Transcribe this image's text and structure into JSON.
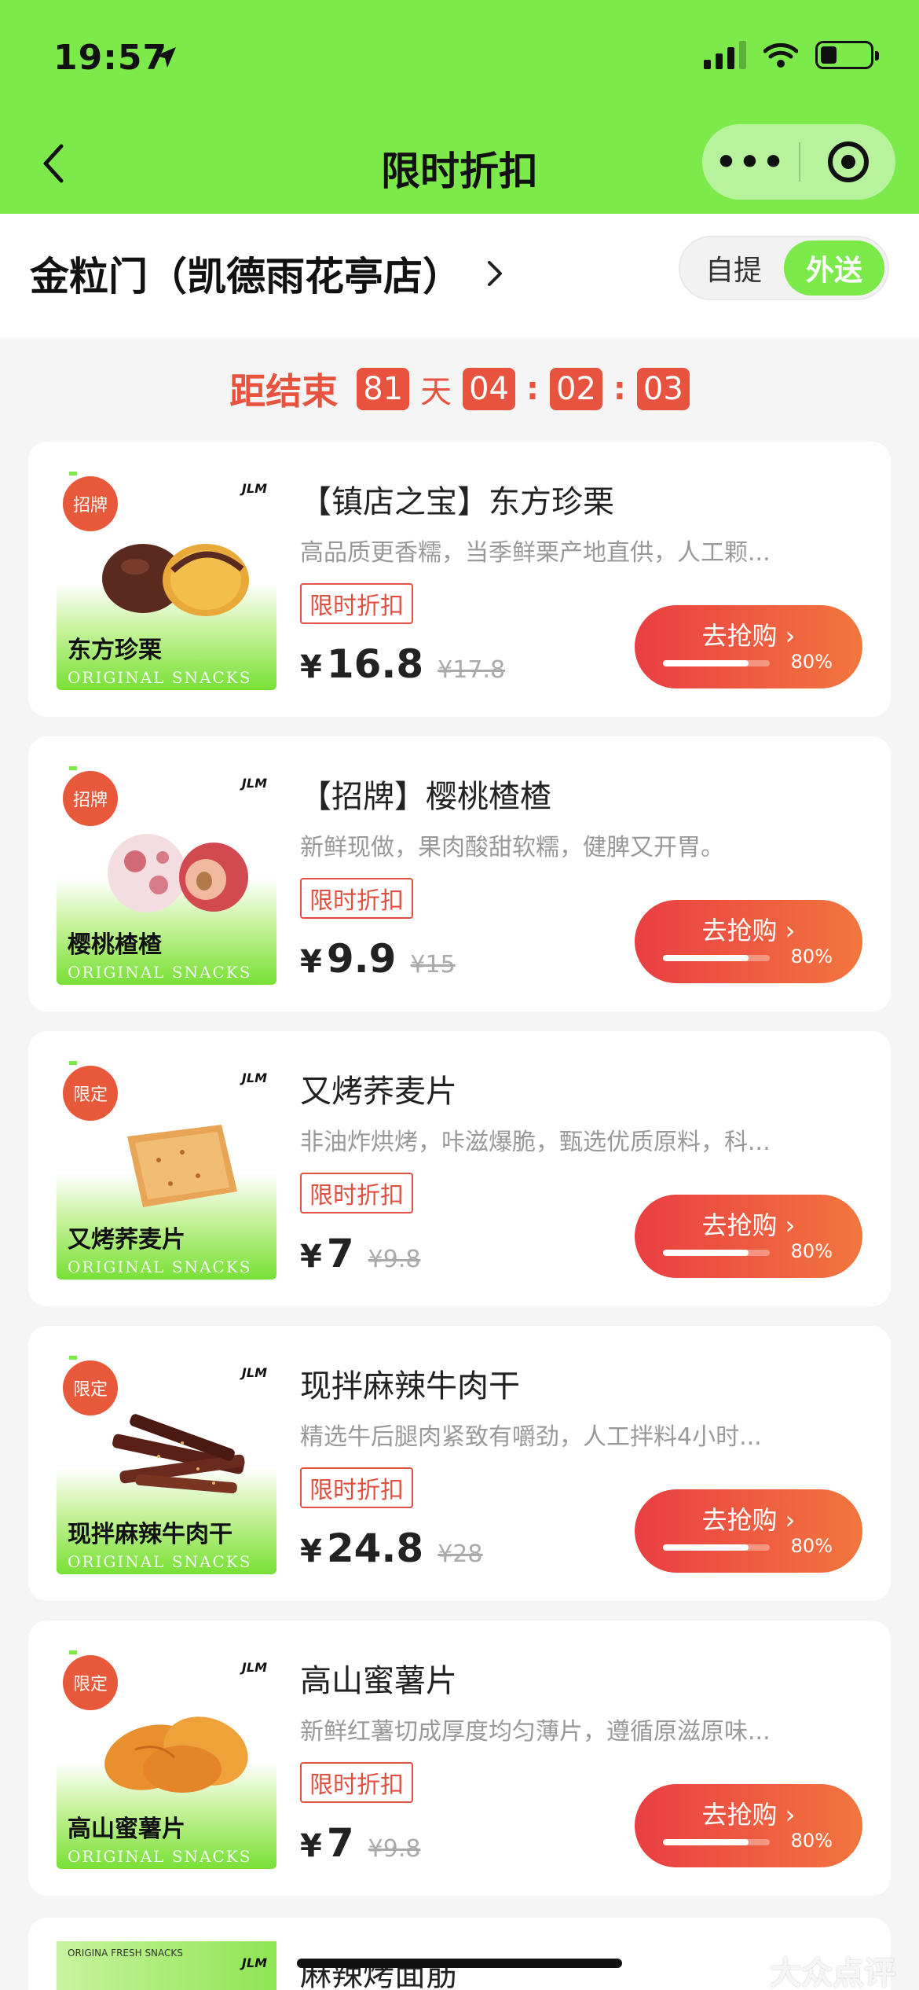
{
  "status_bar": {
    "time": "19:57"
  },
  "nav": {
    "title": "限时折扣",
    "more_icon": "more-dots-icon",
    "target_icon": "target-icon"
  },
  "store": {
    "name": "金粒门（凯德雨花亭店）",
    "pickup": "自提",
    "delivery": "外送",
    "active": "外送"
  },
  "countdown": {
    "label": "距结束",
    "days": "81",
    "day_unit": "天",
    "hours": "04",
    "minutes": "02",
    "seconds": "03",
    "sep": ":"
  },
  "products": [
    {
      "title": "【镇店之宝】东方珍栗",
      "desc": "高品质更香糯，当季鲜栗产地直供，人工颗...",
      "tag": "限时折扣",
      "yen": "¥",
      "price": "16.8",
      "orig_price": "¥17.8",
      "button": "去抢购 ›",
      "progress": 0.8,
      "progress_label": "80%",
      "thumb_tag": "招牌",
      "thumb_name": "东方珍栗",
      "thumb_sub": "ORIGINAL SNACKS",
      "thumb_logo": "JLM"
    },
    {
      "title": "【招牌】樱桃楂楂",
      "desc": "新鲜现做，果肉酸甜软糯，健脾又开胃。",
      "tag": "限时折扣",
      "yen": "¥",
      "price": "9.9",
      "orig_price": "¥15",
      "button": "去抢购 ›",
      "progress": 0.8,
      "progress_label": "80%",
      "thumb_tag": "招牌",
      "thumb_name": "樱桃楂楂",
      "thumb_sub": "ORIGINAL SNACKS",
      "thumb_logo": "JLM"
    },
    {
      "title": "又烤荞麦片",
      "desc": "非油炸烘烤，咔滋爆脆，甄选优质原料，科...",
      "tag": "限时折扣",
      "yen": "¥",
      "price": "7",
      "orig_price": "¥9.8",
      "button": "去抢购 ›",
      "progress": 0.8,
      "progress_label": "80%",
      "thumb_tag": "限定",
      "thumb_name": "又烤荞麦片",
      "thumb_sub": "ORIGINAL SNACKS",
      "thumb_logo": "JLM"
    },
    {
      "title": "现拌麻辣牛肉干",
      "desc": "精选牛后腿肉紧致有嚼劲，人工拌料4小时...",
      "tag": "限时折扣",
      "yen": "¥",
      "price": "24.8",
      "orig_price": "¥28",
      "button": "去抢购 ›",
      "progress": 0.8,
      "progress_label": "80%",
      "thumb_tag": "限定",
      "thumb_name": "现拌麻辣牛肉干",
      "thumb_sub": "ORIGINAL SNACKS",
      "thumb_logo": "JLM"
    },
    {
      "title": "高山蜜薯片",
      "desc": "新鲜红薯切成厚度均匀薄片，遵循原滋原味...",
      "tag": "限时折扣",
      "yen": "¥",
      "price": "7",
      "orig_price": "¥9.8",
      "button": "去抢购 ›",
      "progress": 0.8,
      "progress_label": "80%",
      "thumb_tag": "限定",
      "thumb_name": "高山蜜薯片",
      "thumb_sub": "ORIGINAL SNACKS",
      "thumb_logo": "JLM"
    }
  ],
  "partial_product": {
    "title": "麻辣烤面筋",
    "thumb_text": "ORIGINA FRESH SNACKS",
    "thumb_logo": "JLM"
  },
  "watermark": "大众点评",
  "colors": {
    "brand_green": "#7dea4c",
    "accent_red": "#e8533f",
    "button_start": "#ea3e43",
    "button_end": "#f2763e"
  }
}
